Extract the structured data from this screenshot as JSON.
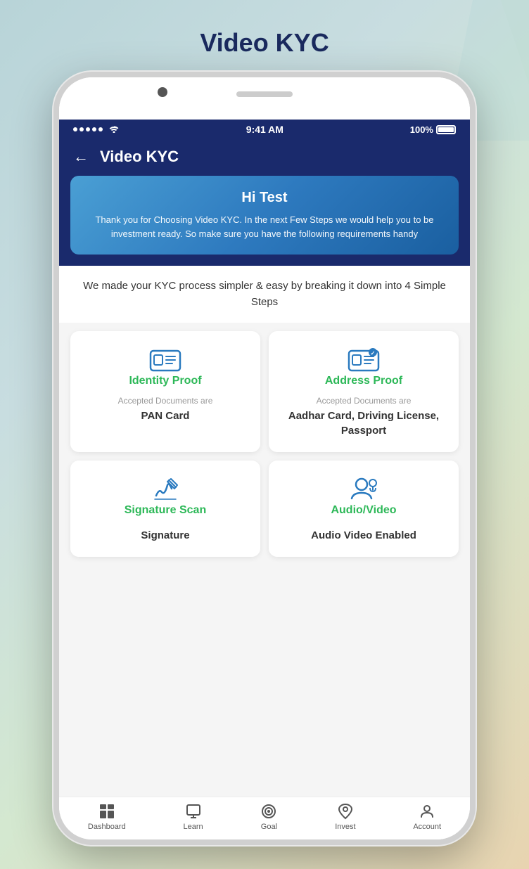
{
  "page": {
    "title": "Video KYC",
    "background_colors": [
      "#b8d4d8",
      "#c8dde0",
      "#d4e8d0",
      "#e8d4b0"
    ]
  },
  "status_bar": {
    "time": "9:41 AM",
    "battery": "100%",
    "signal": "●●●●●",
    "wifi": "wifi"
  },
  "app_header": {
    "back_label": "←",
    "title": "Video KYC"
  },
  "greeting_banner": {
    "title": "Hi Test",
    "subtitle": "Thank you for Choosing Video KYC. In the next Few Steps we would help you to be investment ready. So make sure you have the following requirements handy"
  },
  "steps_description": "We made your KYC process simpler & easy by breaking it down into 4 Simple Steps",
  "cards": [
    {
      "id": "identity-proof",
      "title": "Identity Proof",
      "accepted_label": "Accepted Documents are",
      "docs": "PAN Card"
    },
    {
      "id": "address-proof",
      "title": "Address Proof",
      "accepted_label": "Accepted Documents are",
      "docs": "Aadhar Card, Driving License, Passport"
    },
    {
      "id": "signature-scan",
      "title": "Signature Scan",
      "accepted_label": "",
      "docs": "Signature"
    },
    {
      "id": "audio-video",
      "title": "Audio/Video",
      "accepted_label": "",
      "docs": "Audio Video Enabled"
    }
  ],
  "bottom_nav": [
    {
      "id": "dashboard",
      "label": "Dashboard",
      "icon": "dashboard"
    },
    {
      "id": "learn",
      "label": "Learn",
      "icon": "learn"
    },
    {
      "id": "goal",
      "label": "Goal",
      "icon": "goal"
    },
    {
      "id": "invest",
      "label": "Invest",
      "icon": "invest"
    },
    {
      "id": "account",
      "label": "Account",
      "icon": "account"
    }
  ]
}
